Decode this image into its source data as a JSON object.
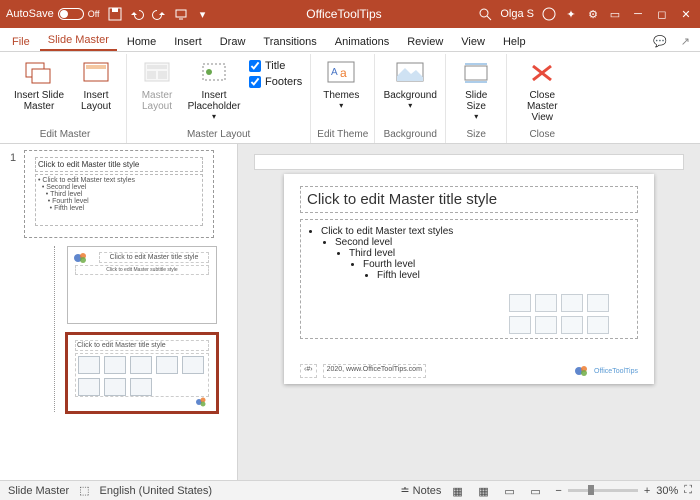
{
  "titlebar": {
    "autosave_label": "AutoSave",
    "autosave_state": "Off",
    "doc_title": "OfficeToolTips",
    "user": "Olga S"
  },
  "tabs": {
    "file": "File",
    "slide_master": "Slide Master",
    "home": "Home",
    "insert": "Insert",
    "draw": "Draw",
    "transitions": "Transitions",
    "animations": "Animations",
    "review": "Review",
    "view": "View",
    "help": "Help"
  },
  "ribbon": {
    "edit_master": {
      "label": "Edit Master",
      "insert_slide_master": "Insert Slide Master",
      "insert_layout": "Insert Layout"
    },
    "master_layout": {
      "label": "Master Layout",
      "master_layout_btn": "Master Layout",
      "insert_placeholder": "Insert Placeholder",
      "chk_title": "Title",
      "chk_footers": "Footers"
    },
    "edit_theme": {
      "label": "Edit Theme",
      "themes": "Themes"
    },
    "background": {
      "label": "Background",
      "background": "Background"
    },
    "size": {
      "label": "Size",
      "slide_size": "Slide Size"
    },
    "close": {
      "label": "Close",
      "close_master": "Close Master View"
    }
  },
  "thumbs": {
    "number": "1",
    "master": {
      "title": "Click to edit Master title style",
      "body": "Click to edit Master text styles",
      "l2": "Second level",
      "l3": "Third level",
      "l4": "Fourth level",
      "l5": "Fifth level"
    },
    "layout1": {
      "title": "Click to edit Master title style",
      "sub": "Click to edit Master subtitle style"
    },
    "layout2": {
      "title": "Click to edit Master title style"
    }
  },
  "slide": {
    "title": "Click to edit Master title style",
    "b1": "Click to edit Master text styles",
    "b2": "Second level",
    "b3": "Third level",
    "b4": "Fourth level",
    "b5": "Fifth level",
    "footer_date": "2020,",
    "footer_link": "www.OfficeToolTips.com",
    "footer_num": "‹#›",
    "footer_logo_text": "OfficeToolTips"
  },
  "status": {
    "view": "Slide Master",
    "lang": "English (United States)",
    "notes": "Notes",
    "zoom": "30%"
  }
}
